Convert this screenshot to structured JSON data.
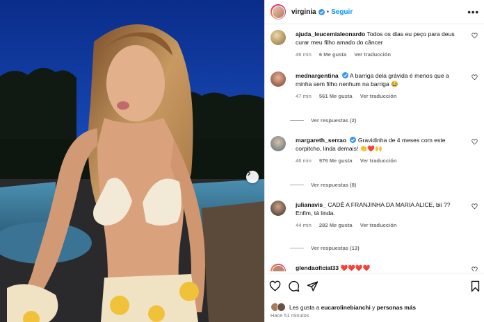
{
  "post": {
    "username": "virginia",
    "follow_label": "Seguir",
    "more_label": "•••"
  },
  "comments": [
    {
      "username": "ajuda_leucemialeonardo",
      "verified": false,
      "text": "Todos os dias eu peço para deus curar meu filho amado do câncer",
      "time": "46 min",
      "likes": "6 Me gusta",
      "translate": "Ver traducción",
      "replies": ""
    },
    {
      "username": "mednargentina",
      "verified": true,
      "text": "A barriga dela grávida é menos que a minha sem filho nenhum na barriga 😂",
      "time": "47 min",
      "likes": "561 Me gusta",
      "translate": "Ver traducción",
      "replies": "Ver respuestas (2)"
    },
    {
      "username": "margareth_serrao",
      "verified": true,
      "text": "Gravidinha de 4 meses com este corpitcho, linda demais! 👏❤️🙌",
      "time": "46 min",
      "likes": "976 Me gusta",
      "translate": "Ver traducción",
      "replies": "Ver respuestas (8)"
    },
    {
      "username": "julianavis_",
      "verified": false,
      "text": "CADÊ A FRANJINHA DA MARIA ALICE, bii ?? Enfim, tá linda.",
      "time": "44 min",
      "likes": "282 Me gusta",
      "translate": "Ver traducción",
      "replies": "Ver respuestas (13)"
    },
    {
      "username": "glendaoficial33",
      "verified": false,
      "text": "❤️❤️❤️❤️",
      "time": "",
      "likes": "",
      "translate": "",
      "replies": ""
    }
  ],
  "likes_line": {
    "prefix": "Les gusta a ",
    "user": "eucarolinebianchi",
    "mid": " y ",
    "others": "personas más"
  },
  "timestamp": "Hace 51 minutos",
  "icons": {
    "verified": "verified-badge-icon",
    "like": "heart-outline-icon",
    "comment": "comment-bubble-icon",
    "share": "paper-plane-icon",
    "save": "bookmark-icon",
    "next": "chevron-right-icon"
  },
  "colors": {
    "accent": "#0095f6",
    "muted": "#737373",
    "verified": "#3897f0"
  }
}
